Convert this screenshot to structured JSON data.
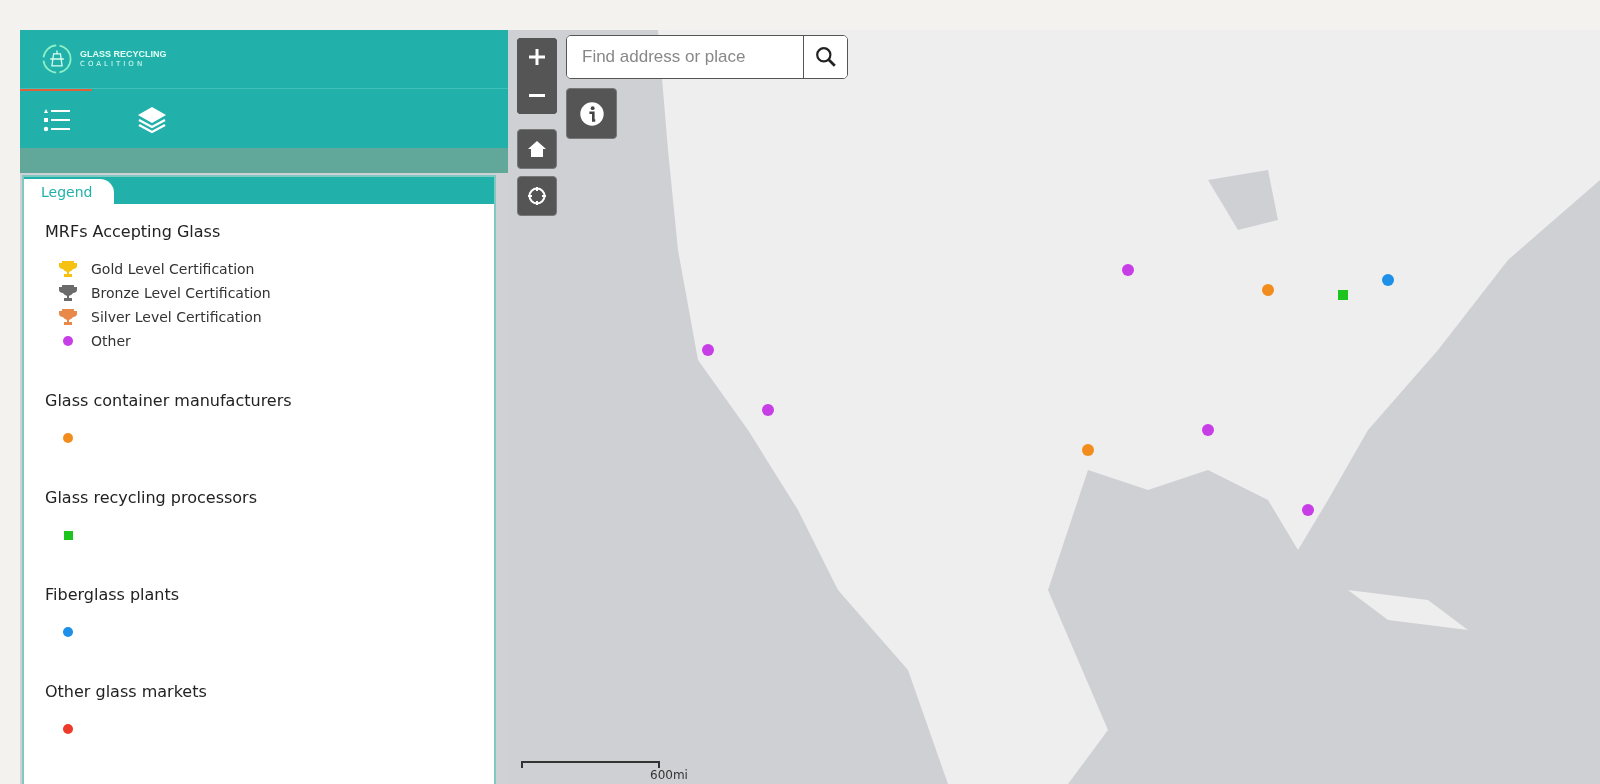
{
  "header": {
    "logo_line_1": "GLASS RECYCLING",
    "logo_line_2": "COALITION"
  },
  "panel_tabs": [
    {
      "kind": "legend",
      "selected": true
    },
    {
      "kind": "layers",
      "selected": false
    }
  ],
  "legend": {
    "tab_label": "Legend",
    "sections": [
      {
        "title": "MRFs Accepting Glass",
        "items": [
          {
            "kind": "trophy",
            "color": "#f5c211",
            "label": "Gold Level Certification"
          },
          {
            "kind": "trophy",
            "color": "#6b6b6b",
            "label": "Bronze Level Certification"
          },
          {
            "kind": "trophy",
            "color": "#e8894a",
            "label": "Silver Level Certification"
          },
          {
            "kind": "dot",
            "color": "#c83ee6",
            "label": "Other"
          }
        ]
      },
      {
        "title": "Glass container manufacturers",
        "items": [
          {
            "kind": "dot",
            "color": "#f28c1c"
          }
        ]
      },
      {
        "title": "Glass recycling processors",
        "items": [
          {
            "kind": "square",
            "color": "#1ec41e"
          }
        ]
      },
      {
        "title": "Fiberglass plants",
        "items": [
          {
            "kind": "dot",
            "color": "#1e90e8"
          }
        ]
      },
      {
        "title": "Other glass markets",
        "items": [
          {
            "kind": "dot",
            "color": "#ee3a2a"
          }
        ]
      }
    ]
  },
  "map": {
    "search": {
      "placeholder": "Find address or place"
    },
    "scale": {
      "label": "600mi"
    }
  }
}
